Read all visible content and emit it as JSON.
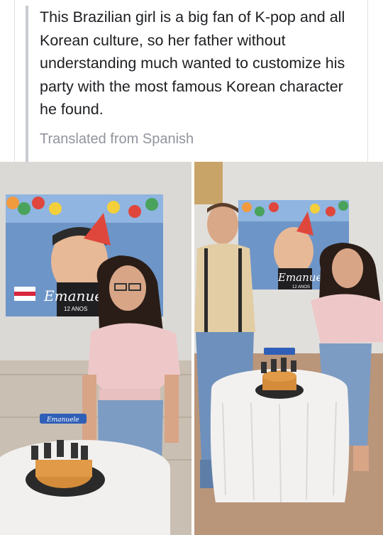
{
  "post": {
    "text": "This Brazilian girl is a big fan of K-pop and all Korean culture, so her father without understanding much wanted to customize his party with the most famous Korean character he found.",
    "translated_label": "Translated from Spanish"
  },
  "photos": {
    "left": {
      "banner_name": "Emanuel",
      "banner_sub": "12 ANOS",
      "cake_topper": "Emanuele"
    },
    "right": {
      "banner_name": "Emanuela",
      "banner_sub": "12 ANOS"
    }
  }
}
